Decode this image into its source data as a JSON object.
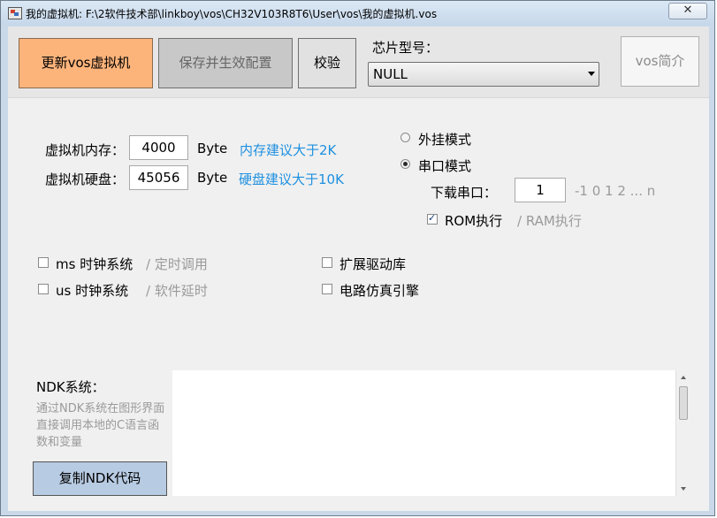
{
  "window": {
    "title": "我的虚拟机: F:\\2软件技术部\\linkboy\\vos\\CH32V103R8T6\\User\\vos\\我的虚拟机.vos",
    "close_label": "✕"
  },
  "toolbar": {
    "update_label": "更新vos虚拟机",
    "save_label": "保存并生效配置",
    "verify_label": "校验",
    "chip_label": "芯片型号：",
    "chip_value": "NULL",
    "intro_label": "vos简介"
  },
  "memory": {
    "label": "虚拟机内存：",
    "value": "4000",
    "unit": "Byte",
    "hint": "内存建议大于2K"
  },
  "disk": {
    "label": "虚拟机硬盘：",
    "value": "45056",
    "unit": "Byte",
    "hint": "硬盘建议大于10K"
  },
  "mode": {
    "external_label": "外挂模式",
    "serial_label": "串口模式",
    "selected": "serial",
    "port_label": "下载串口：",
    "port_value": "1",
    "port_hint": "-1 0 1 2 ... n",
    "rom_label": "ROM执行",
    "rom_checked": true,
    "ram_hint": "/ RAM执行"
  },
  "options": {
    "ms_label": "ms 时钟系统",
    "ms_hint": "/ 定时调用",
    "us_label": "us 时钟系统",
    "us_hint": "/ 软件延时",
    "driver_label": "扩展驱动库",
    "circuit_label": "电路仿真引擎"
  },
  "ndk": {
    "title": "NDK系统：",
    "description": "通过NDK系统在图形界面直接调用本地的C语言函数和变量",
    "copy_label": "复制NDK代码",
    "code_text": ""
  },
  "colors": {
    "update_button": "#fdb47b",
    "hint_blue": "#1e90e0",
    "copy_button": "#b7cbe2"
  }
}
